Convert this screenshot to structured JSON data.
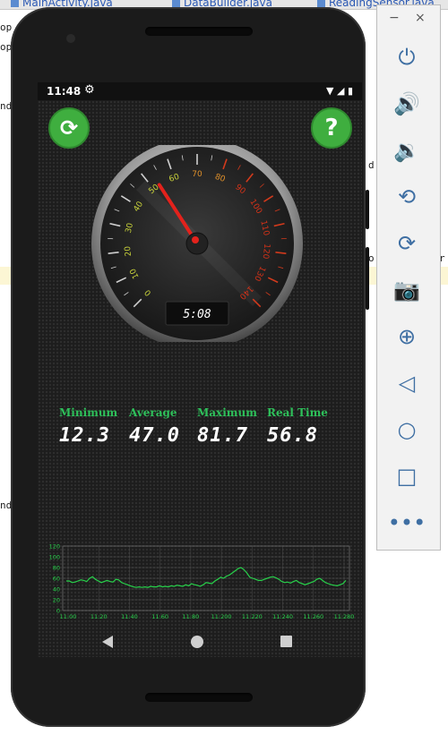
{
  "ide": {
    "tabs": [
      "MainActivity.java",
      "DataBuilder.java",
      "ReadingSensor.java"
    ],
    "fragments": [
      "op",
      "op",
      "nd",
      "d",
      "o",
      "r",
      "nd"
    ]
  },
  "status_bar": {
    "time": "11:48",
    "settings_icon": "gear-icon",
    "right_icons": "wifi-icon signal-icon battery-icon"
  },
  "app": {
    "top_left_button_icon": "refresh-icon",
    "top_right_button_icon": "help-icon",
    "help_glyph": "?",
    "refresh_glyph": "⟳",
    "gauge": {
      "ticks": [
        0,
        10,
        20,
        30,
        40,
        50,
        60,
        70,
        80,
        90,
        100,
        110,
        120,
        130,
        140
      ],
      "needle_value": 53,
      "max": 140,
      "timer_display": "5:08"
    },
    "stats": {
      "min_label": "Minimum",
      "avg_label": "Average",
      "max_label": "Maximum",
      "rt_label": "Real Time",
      "min_value": "12.3",
      "avg_value": "47.0",
      "max_value": "81.7",
      "rt_value": "56.8"
    },
    "colors": {
      "accent_green": "#2ec05a",
      "button_green": "#3fae3f",
      "needle_red": "#e3221c"
    }
  },
  "chart_data": {
    "type": "line",
    "y_ticks": [
      0,
      20,
      40,
      60,
      80,
      100,
      120
    ],
    "x_tick_labels": [
      "11:00",
      "11:20",
      "11:40",
      "11:60",
      "11:80",
      "11:200",
      "11:220",
      "11:240",
      "11:260",
      "11:280"
    ],
    "ylim": [
      0,
      120
    ],
    "grid": true,
    "series": [
      {
        "values": [
          55,
          55,
          52,
          53,
          55,
          57,
          56,
          54,
          60,
          63,
          58,
          55,
          52,
          54,
          56,
          54,
          53,
          58,
          57,
          52,
          50,
          48,
          46,
          44,
          43,
          44,
          43,
          44,
          43,
          45,
          44,
          44,
          46,
          44,
          45,
          44,
          46,
          45,
          47,
          46,
          45,
          48,
          46,
          50,
          48,
          47,
          45,
          48,
          52,
          51,
          50,
          55,
          58,
          62,
          60,
          64,
          66,
          70,
          74,
          78,
          80,
          76,
          70,
          62,
          60,
          58,
          56,
          56,
          58,
          60,
          62,
          63,
          61,
          58,
          54,
          52,
          53,
          51,
          54,
          56,
          52,
          50,
          48,
          50,
          52,
          54,
          58,
          60,
          56,
          52,
          50,
          48,
          47,
          46,
          48,
          50,
          56
        ]
      }
    ]
  },
  "navbar": {
    "back": "back-icon",
    "home": "home-icon",
    "recent": "recent-apps-icon"
  },
  "emulator_panel": {
    "minimize": "−",
    "close": "×",
    "icons": [
      "power-icon",
      "volume-up-icon",
      "volume-down-icon",
      "rotate-left-icon",
      "rotate-right-icon",
      "camera-icon",
      "zoom-icon",
      "back-icon",
      "home-icon",
      "overview-icon",
      "more-icon"
    ]
  }
}
